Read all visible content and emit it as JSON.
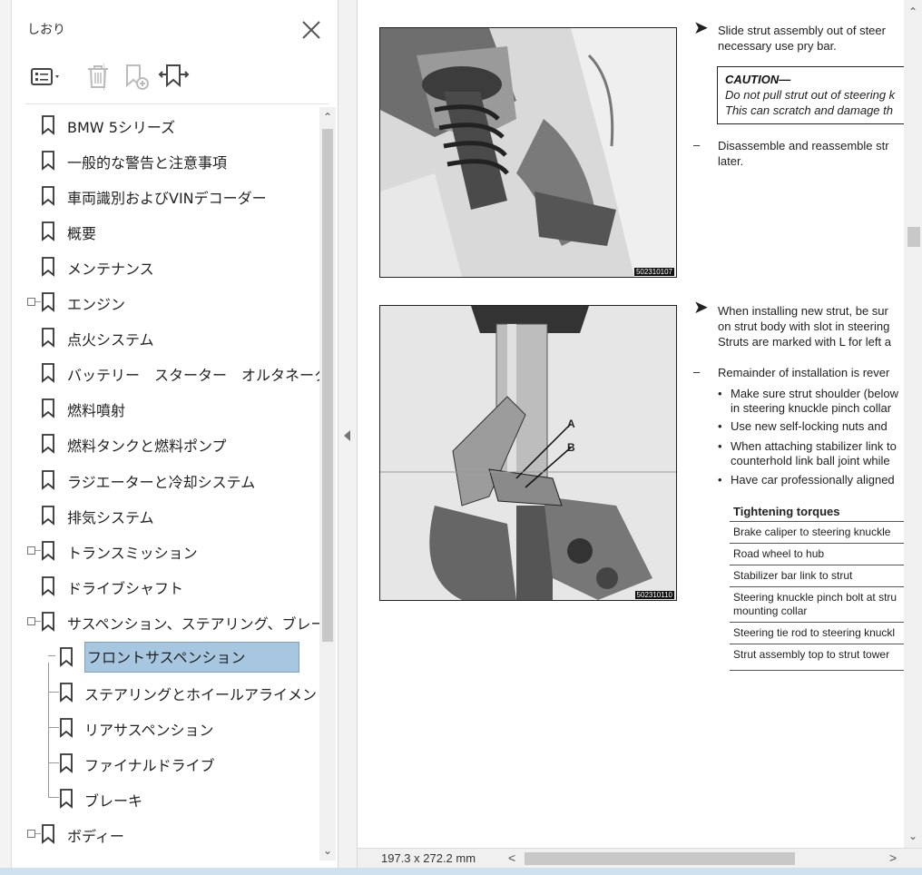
{
  "panel": {
    "title": "しおり",
    "items": [
      {
        "label": "BMW 5シリーズ"
      },
      {
        "label": "一般的な警告と注意事項"
      },
      {
        "label": "車両識別およびVINデコーダー"
      },
      {
        "label": "概要"
      },
      {
        "label": "メンテナンス"
      },
      {
        "label": "エンジン"
      },
      {
        "label": "点火システム"
      },
      {
        "label": "バッテリー　スターター　オルタネーター"
      },
      {
        "label": "燃料噴射"
      },
      {
        "label": "燃料タンクと燃料ポンプ"
      },
      {
        "label": "ラジエーターと冷却システム"
      },
      {
        "label": "排気システム"
      },
      {
        "label": "トランスミッション"
      },
      {
        "label": "ドライブシャフト"
      },
      {
        "label": "サスペンション、ステアリング、ブレーキ全般"
      },
      {
        "label": "フロントサスペンション"
      },
      {
        "label": "ステアリングとホイールアライメント"
      },
      {
        "label": "リアサスペンション"
      },
      {
        "label": "ファイナルドライブ"
      },
      {
        "label": "ブレーキ"
      },
      {
        "label": "ボディー"
      }
    ]
  },
  "doc": {
    "photo1_code": "502310107",
    "photo2_code": "502310110",
    "label_a": "A",
    "label_b": "B",
    "p1_line1": "Slide strut assembly out of steer",
    "p1_line2": "necessary use pry bar.",
    "caution_title": "CAUTION—",
    "caution_line1": "Do not pull strut out of steering k",
    "caution_line2": "This can scratch and damage th",
    "p2_line1": "Disassemble and reassemble str",
    "p2_line2": "later.",
    "p3_line1": "When installing new strut, be sur",
    "p3_line2": "on strut body with slot in steering",
    "p3_line3": "Struts are marked with L for left a",
    "p4_line1": "Remainder of installation is rever",
    "b1_line1": "Make sure strut shoulder (below",
    "b1_line2": "in steering knuckle pinch collar",
    "b2_line1": "Use new self-locking nuts and",
    "b3_line1": "When attaching stabilizer link to",
    "b3_line2": "counterhold link ball joint while",
    "b4_line1": "Have car professionally aligned",
    "torque_title": "Tightening torques",
    "torques": [
      {
        "line1": "Brake caliper to steering knuckle",
        "line2": ""
      },
      {
        "line1": "Road wheel to hub",
        "line2": ""
      },
      {
        "line1": "Stabilizer bar link to strut",
        "line2": ""
      },
      {
        "line1": "Steering knuckle pinch bolt at stru",
        "line2": "mounting collar"
      },
      {
        "line1": "Steering tie rod to steering knuckl",
        "line2": ""
      },
      {
        "line1": "Strut assembly top to strut tower",
        "line2": ""
      }
    ]
  },
  "status": {
    "page_size": "197.3 x 272.2 mm"
  },
  "colors": {
    "selection": "#a7c6e0",
    "selection_border": "#7aa0c4"
  }
}
